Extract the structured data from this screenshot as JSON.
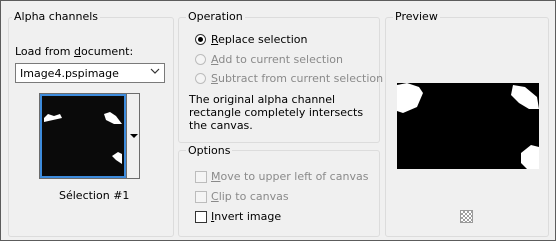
{
  "alpha_channels": {
    "title": "Alpha channels",
    "load_from_label_prefix": "Load from ",
    "load_from_label_underlined": "d",
    "load_from_label_rest": "ocument:",
    "document_select_value": "Image4.pspimage",
    "thumbnail_caption": "Sélection #1"
  },
  "operation": {
    "title": "Operation",
    "options": [
      {
        "underline": "R",
        "rest": "eplace selection",
        "selected": true,
        "enabled": true
      },
      {
        "underline": "A",
        "rest": "dd to current selection",
        "selected": false,
        "enabled": false
      },
      {
        "underline": "S",
        "rest": "ubtract from current selection",
        "selected": false,
        "enabled": false
      }
    ],
    "description": "The original alpha channel rectangle completely intersects the canvas."
  },
  "options": {
    "title": "Options",
    "checkboxes": [
      {
        "underline": "M",
        "rest": "ove to upper left of canvas",
        "checked": false,
        "enabled": false
      },
      {
        "underline": "C",
        "rest": "lip to canvas",
        "checked": false,
        "enabled": false
      },
      {
        "underline": "I",
        "rest": "nvert image",
        "checked": false,
        "enabled": true
      }
    ]
  },
  "preview": {
    "title": "Preview",
    "toggle_icon": "checkerboard-icon"
  }
}
